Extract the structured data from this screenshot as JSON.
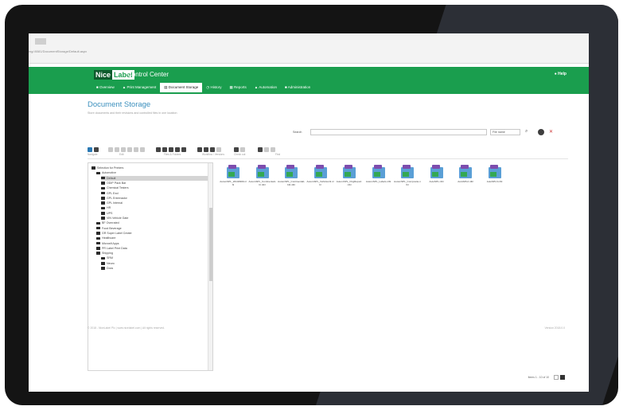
{
  "browser": {
    "url": "ing/:8081/DocumentStorage/Default.aspx"
  },
  "header": {
    "logo_nice": "Nice",
    "logo_label": "Label",
    "app_title": "Control Center",
    "help": "Help"
  },
  "nav": {
    "tabs": [
      {
        "label": "Overview"
      },
      {
        "label": "Print Management"
      },
      {
        "label": "Document Storage"
      },
      {
        "label": "History"
      },
      {
        "label": "Reports"
      },
      {
        "label": "Automation"
      },
      {
        "label": "Administration"
      }
    ],
    "active": "Document Storage"
  },
  "page": {
    "title": "Document Storage",
    "subtitle": "Store documents and their revisions and controlled files in one location"
  },
  "search": {
    "label": "Search",
    "value": "",
    "scope": "File name",
    "search_icon": "magnifier-icon",
    "settings_icon": "gear-icon",
    "close_icon": "close-icon"
  },
  "toolbar": {
    "groups": [
      {
        "caption": "Navigate"
      },
      {
        "caption": "Edit"
      },
      {
        "caption": "Files & Folders"
      },
      {
        "caption": "Workflow / Versions"
      },
      {
        "caption": "Check out"
      },
      {
        "caption": "Find"
      }
    ]
  },
  "tree": {
    "items": [
      {
        "label": "Selection for Printers",
        "depth": 0
      },
      {
        "label": "Automotive",
        "depth": 1
      },
      {
        "label": "Default",
        "depth": 2,
        "selected": true
      },
      {
        "label": "ODIP Pack Bar",
        "depth": 2
      },
      {
        "label": "Chemical Testers",
        "depth": 2
      },
      {
        "label": "GPL Excl",
        "depth": 2
      },
      {
        "label": "GPL Entrenador",
        "depth": 2
      },
      {
        "label": "GPL Internal",
        "depth": 2
      },
      {
        "label": "HR",
        "depth": 2
      },
      {
        "label": "UPS",
        "depth": 2
      },
      {
        "label": "VIN Vehicle Gate",
        "depth": 2
      },
      {
        "label": "BF Overrated",
        "depth": 1
      },
      {
        "label": "Food Beverage",
        "depth": 1
      },
      {
        "label": "GR Super Label Create",
        "depth": 1
      },
      {
        "label": "Healthcare",
        "depth": 1
      },
      {
        "label": "Microsft Apps",
        "depth": 1
      },
      {
        "label": "PR Label Print Data",
        "depth": 1
      },
      {
        "label": "Shipping",
        "depth": 1
      },
      {
        "label": "SRM",
        "depth": 2
      },
      {
        "label": "Neuro",
        "depth": 2
      },
      {
        "label": "Docs",
        "depth": 2
      }
    ]
  },
  "files": [
    {
      "name": "AutomSPL_20140909.nlbl"
    },
    {
      "name": "AutomSPL_ContinentalLbl.nlbl"
    },
    {
      "name": "AutomSPL_ContinentalLbl2.nlbl"
    },
    {
      "name": "AutomSPL_VehicleLbl.nlbl"
    },
    {
      "name": "AutomSPL_OngReport.nlbl"
    },
    {
      "name": "AutomSPL_Labels.nlbl"
    },
    {
      "name": "AutomSPL_Composite.nlbl"
    },
    {
      "name": "AutoSPL.nlbl"
    },
    {
      "name": "AutoSPL2.nlbl"
    },
    {
      "name": "AutoSPL3.nlbl"
    }
  ],
  "pager": {
    "label": "Items 1 - 10 of 10"
  },
  "footer": {
    "left": "© 2018 - NiceLabel Plc | www.nicelabel.com | All rights reserved.",
    "right": "Version 2018.0.0"
  }
}
